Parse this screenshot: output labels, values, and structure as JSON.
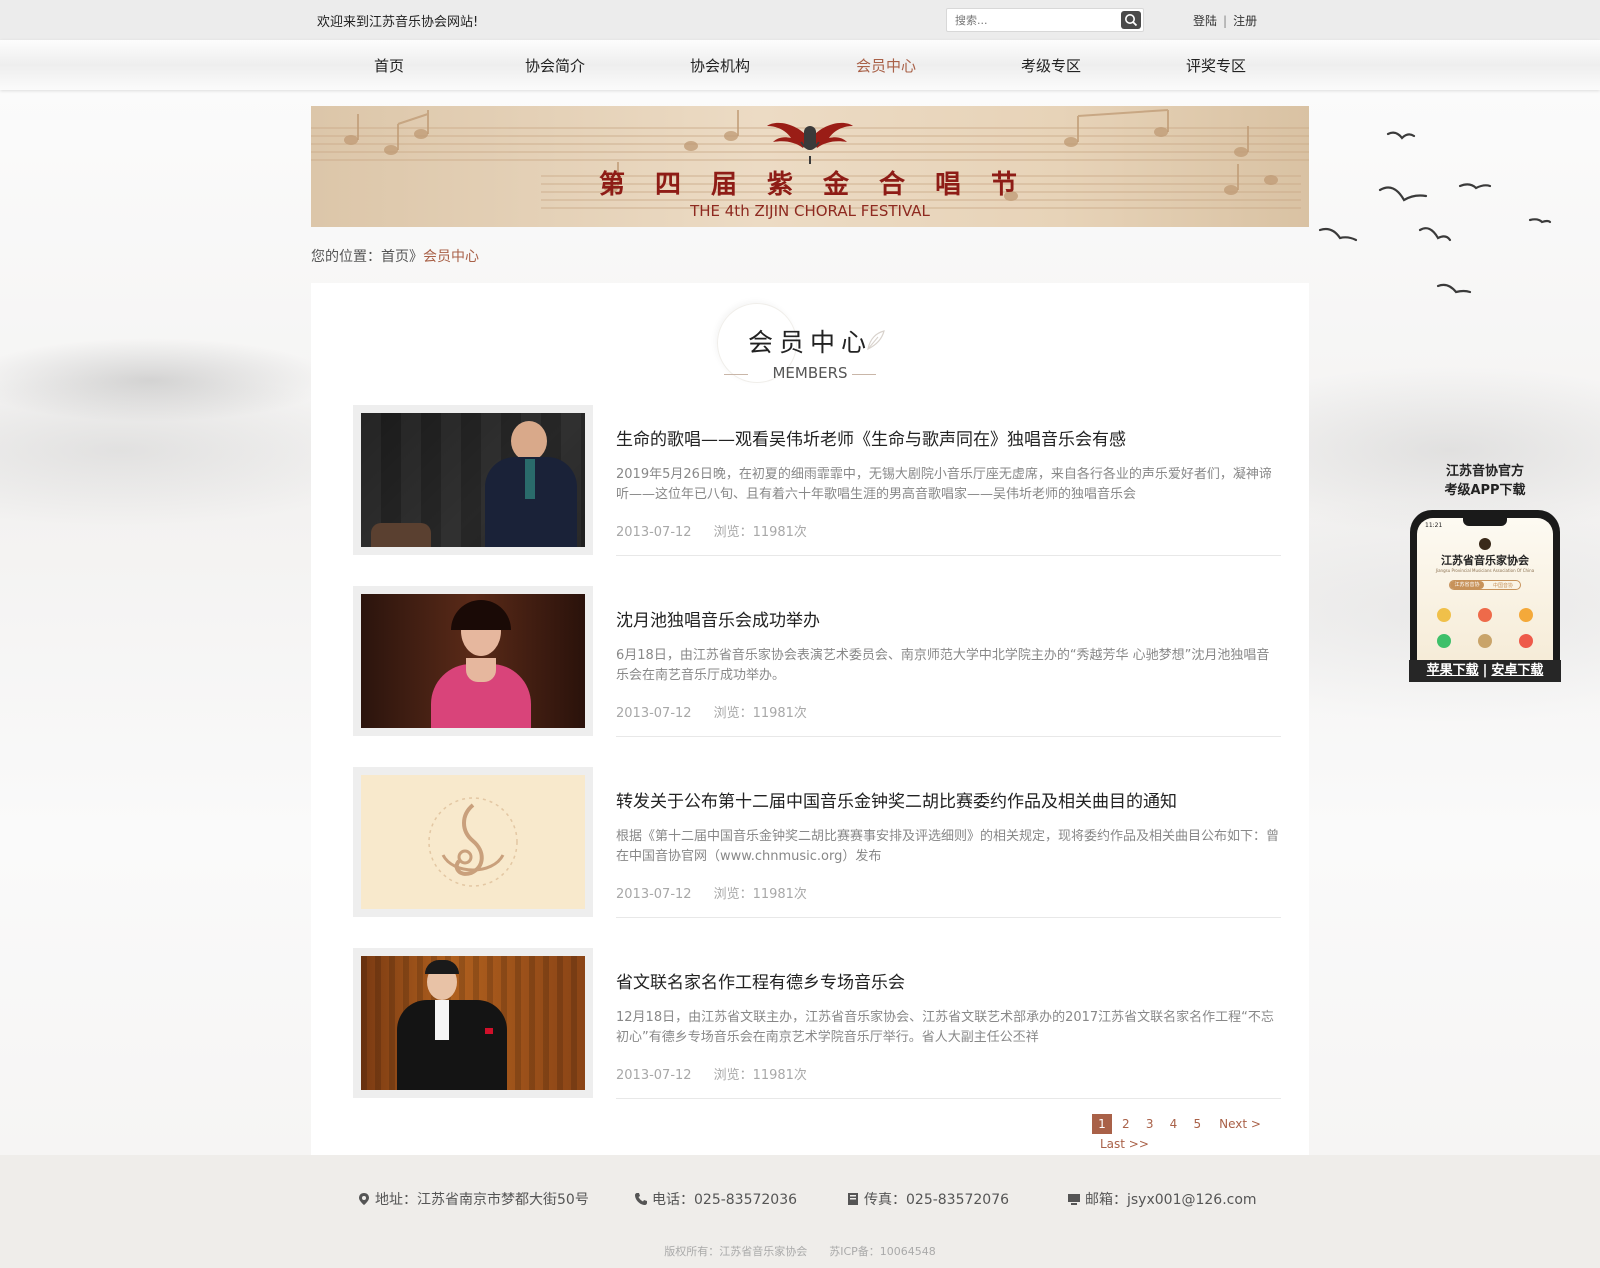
{
  "topbar": {
    "welcome": "欢迎来到江苏音乐协会网站!",
    "search_placeholder": "搜索...",
    "login": "登陆",
    "register": "注册"
  },
  "nav": {
    "items": [
      {
        "label": "首页",
        "active": false
      },
      {
        "label": "协会简介",
        "active": false
      },
      {
        "label": "协会机构",
        "active": false
      },
      {
        "label": "会员中心",
        "active": true
      },
      {
        "label": "考级专区",
        "active": false
      },
      {
        "label": "评奖专区",
        "active": false
      }
    ],
    "active_color": "#a96148"
  },
  "banner": {
    "title": "第四届紫金合唱节",
    "subtitle": "THE 4th ZIJIN CHORAL FESTIVAL"
  },
  "breadcrumb": {
    "prefix": "您的位置：",
    "home": "首页",
    "sep": "》",
    "current": "会员中心"
  },
  "section": {
    "title_cn": "会员中心",
    "title_en": "MEMBERS"
  },
  "articles": [
    {
      "title": "生命的歌唱——观看吴伟圻老师《生命与歌声同在》独唱音乐会有感",
      "desc": "2019年5月26日晚，在初夏的细雨霏霏中，无锡大剧院小音乐厅座无虚席，来自各行各业的声乐爱好者们，凝神谛听——这位年已八旬、且有着六十年歌唱生涯的男高音歌唱家——吴伟圻老师的独唱音乐会",
      "date": "2013-07-12",
      "views": "浏览：11981次"
    },
    {
      "title": "沈月池独唱音乐会成功举办",
      "desc": "6月18日，由江苏省音乐家协会表演艺术委员会、南京师范大学中北学院主办的“秀越芳华 心驰梦想”沈月池独唱音乐会在南艺音乐厅成功举办。",
      "date": "2013-07-12",
      "views": "浏览：11981次"
    },
    {
      "title": "转发关于公布第十二届中国音乐金钟奖二胡比赛委约作品及相关曲目的通知",
      "desc": "根据《第十二届中国音乐金钟奖二胡比赛赛事安排及评选细则》的相关规定，现将委约作品及相关曲目公布如下：曾在中国音协官网（www.chnmusic.org）发布",
      "date": "2013-07-12",
      "views": "浏览：11981次"
    },
    {
      "title": "省文联名家名作工程有德乡专场音乐会",
      "desc": "12月18日，由江苏省文联主办，江苏省音乐家协会、江苏省文联艺术部承办的2017江苏省文联名家名作工程“不忘初心”有德乡专场音乐会在南京艺术学院音乐厅举行。省人大副主任公丕祥",
      "date": "2013-07-12",
      "views": "浏览：11981次"
    }
  ],
  "pagination": {
    "pages": [
      "1",
      "2",
      "3",
      "4",
      "5"
    ],
    "current": "1",
    "next": "Next >",
    "last": "Last >>"
  },
  "app": {
    "title_line1": "江苏音协官方",
    "title_line2": "考级APP下载",
    "phone_time": "11:21",
    "phone_app_name": "江苏省音乐家协会",
    "phone_app_en": "Jiangsu Provincial Musicians Association Of China",
    "phone_tab1": "江苏省音协",
    "phone_tab2": "中国音协",
    "ios_label": "苹果下载",
    "android_label": "安卓下载"
  },
  "footer": {
    "address": "地址：江苏省南京市梦都大街50号",
    "phone": "电话：025-83572036",
    "fax": "传真：025-83572076",
    "email": "邮箱：jsyx001@126.com",
    "copyright": "版权所有：江苏省音乐家协会",
    "icp": "苏ICP备：10064548"
  }
}
